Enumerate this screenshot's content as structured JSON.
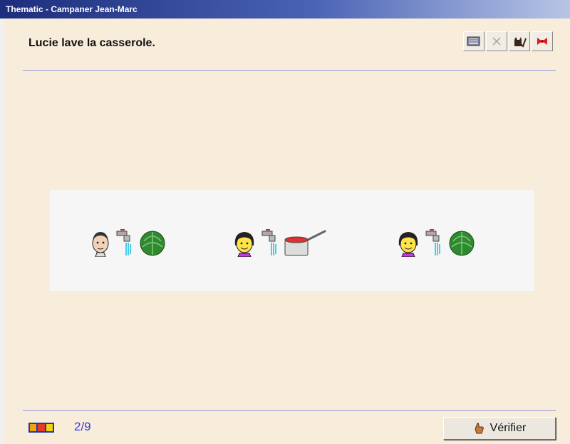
{
  "window": {
    "title": "Thematic - Campaner Jean-Marc"
  },
  "instruction": "Lucie lave la casserole.",
  "toolbar": {
    "buttons": [
      {
        "icon": "notebook-icon"
      },
      {
        "icon": "close-x-icon"
      },
      {
        "icon": "cat-check-icon"
      },
      {
        "icon": "exit-icon"
      }
    ]
  },
  "choices": [
    {
      "subject": "boy-face",
      "action": "faucet",
      "object": "cabbage"
    },
    {
      "subject": "girl-face",
      "action": "faucet",
      "object": "saucepan"
    },
    {
      "subject": "girl-face",
      "action": "faucet",
      "object": "cabbage"
    }
  ],
  "footer": {
    "logo_icon": "jmc-logo",
    "progress": "2/9",
    "verify_label": "Vérifier"
  },
  "colors": {
    "accent": "#3b3bd8",
    "rule": "#8f96d6",
    "titlebar": "#1d2d7c"
  }
}
